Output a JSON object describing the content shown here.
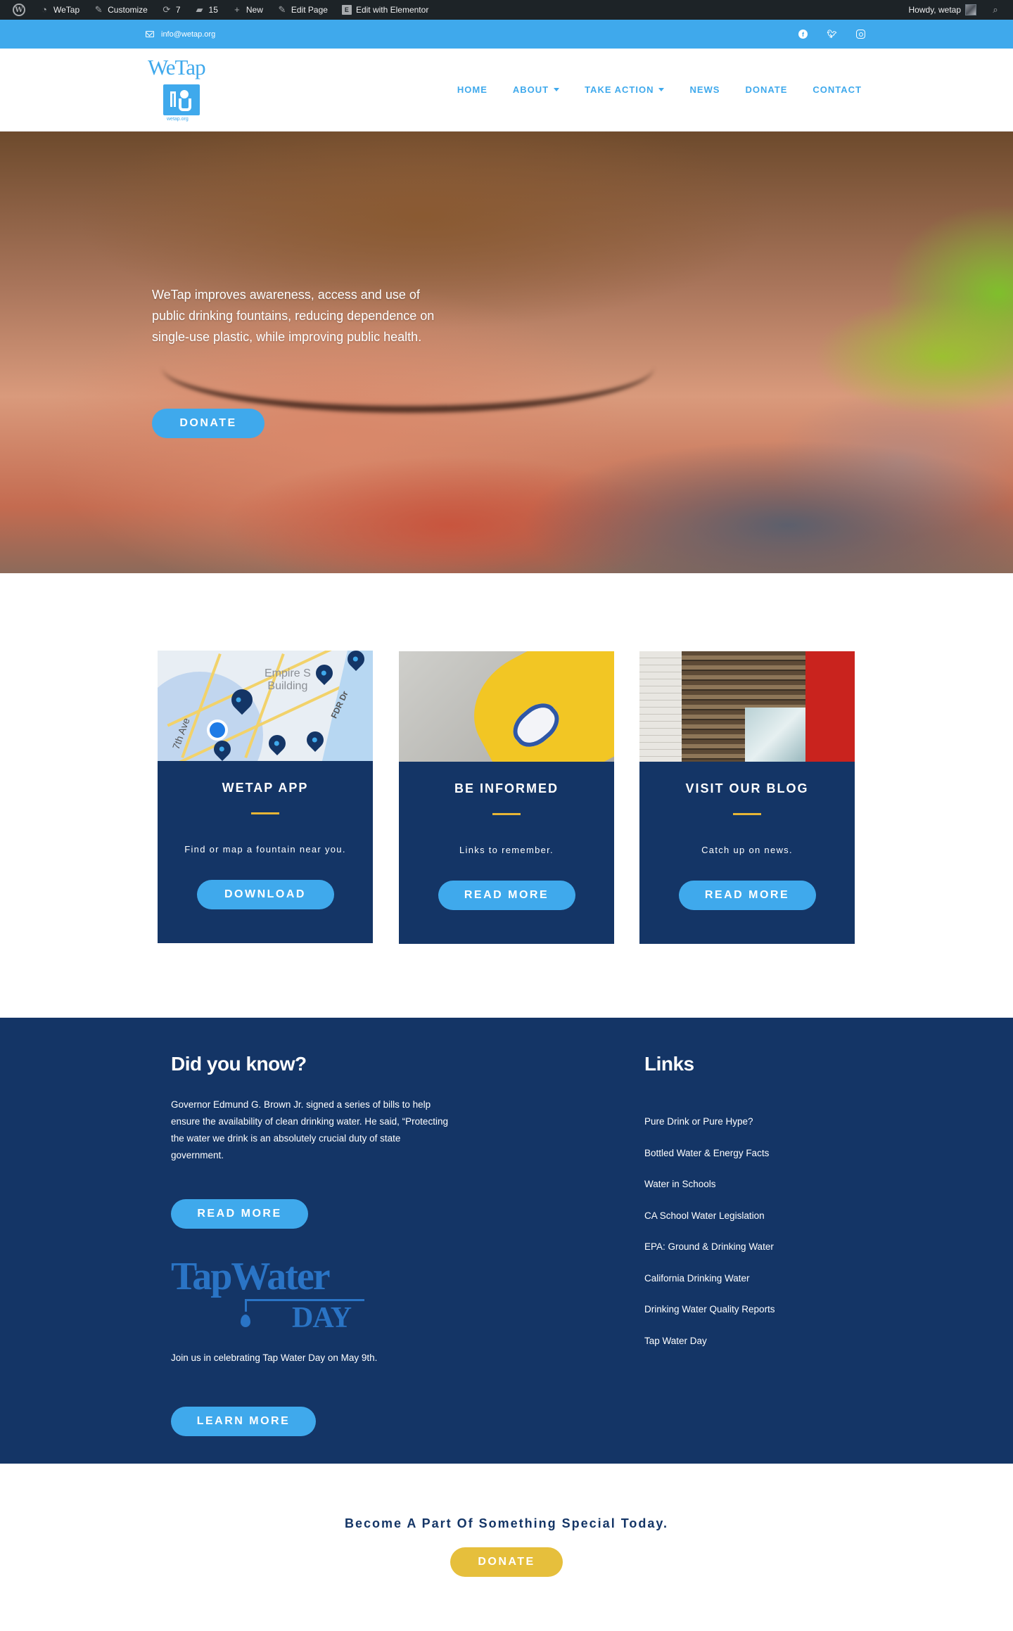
{
  "admin_bar": {
    "site_name": "WeTap",
    "customize": "Customize",
    "updates_count": "7",
    "comments_count": "15",
    "new_label": "New",
    "edit_page": "Edit Page",
    "edit_elementor": "Edit with Elementor",
    "howdy": "Howdy, wetap"
  },
  "topbar": {
    "email": "info@wetap.org"
  },
  "logo": {
    "text": "WeTap",
    "sub": "wetap.org"
  },
  "nav": {
    "items": [
      "HOME",
      "ABOUT",
      "TAKE ACTION",
      "NEWS",
      "DONATE",
      "CONTACT"
    ]
  },
  "hero": {
    "text": "WeTap improves awareness, access and use of public drinking fountains, reducing dependence on single-use plastic, while improving public health.",
    "button": "DONATE"
  },
  "cards": [
    {
      "title": "WETAP APP",
      "desc": "Find or map a fountain near you.",
      "button": "DOWNLOAD",
      "map_label_1": "Empire S",
      "map_label_2": "Building",
      "map_street": "7th Ave",
      "map_road": "FDR Dr"
    },
    {
      "title": "BE INFORMED",
      "desc": "Links to remember.",
      "button": "READ MORE"
    },
    {
      "title": "VISIT OUR BLOG",
      "desc": "Catch up on news.",
      "button": "READ MORE"
    }
  ],
  "did_you_know": {
    "heading": "Did you know?",
    "text": "Governor Edmund G. Brown Jr. signed a series of bills to help ensure the availability of clean drinking water. He said, “Protecting the water we drink is an absolutely crucial duty of state government.",
    "button": "READ MORE",
    "tap_water_day": {
      "word1": "TapWater",
      "word2": "DAY"
    },
    "tap_text": "Join us in celebrating Tap Water Day on May 9th.",
    "tap_button": "LEARN MORE"
  },
  "links": {
    "heading": "Links",
    "items": [
      "Pure Drink or Pure Hype?",
      "Bottled Water & Energy Facts",
      "Water in Schools",
      "CA School Water Legislation",
      "EPA: Ground & Drinking Water",
      "California Drinking Water",
      "Drinking Water Quality Reports",
      "Tap Water Day"
    ]
  },
  "cta": {
    "text": "Become A Part Of Something Special Today.",
    "button": "DONATE"
  },
  "colors": {
    "navy": "#143566",
    "sky": "#3fa9ec",
    "gold": "#e6bf3c"
  }
}
